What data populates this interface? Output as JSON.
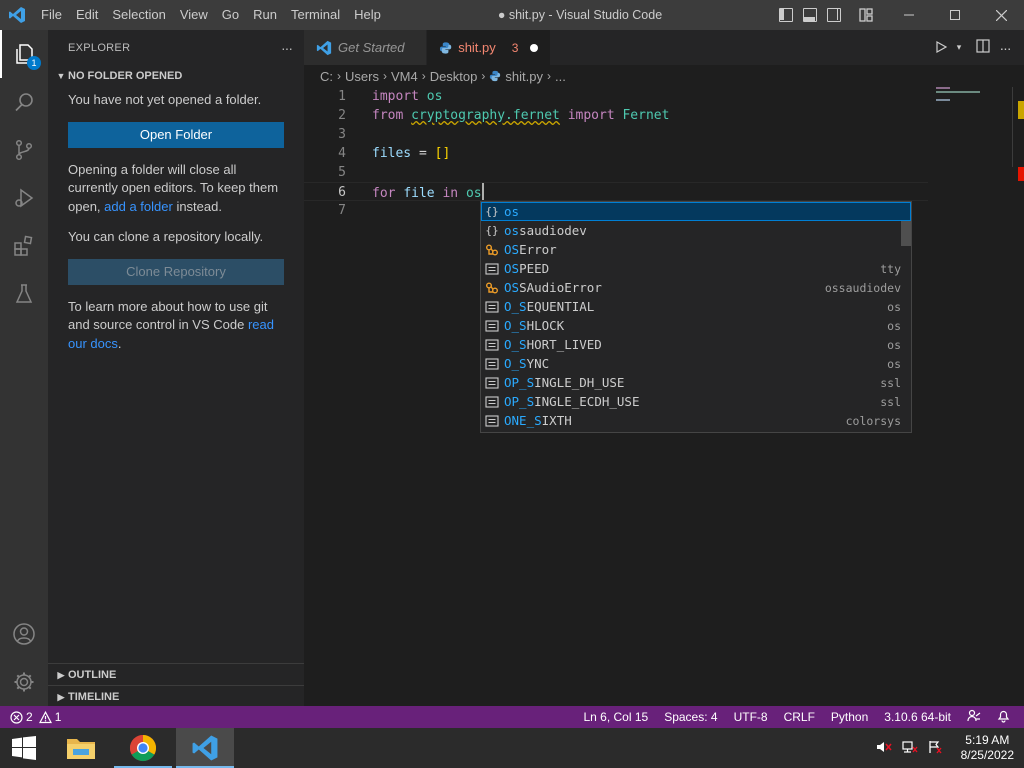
{
  "window": {
    "title": "● shit.py - Visual Studio Code"
  },
  "menu": [
    "File",
    "Edit",
    "Selection",
    "View",
    "Go",
    "Run",
    "Terminal",
    "Help"
  ],
  "activity": {
    "explorer_badge": "1"
  },
  "sidebar": {
    "header": "EXPLORER",
    "more": "···",
    "section": "NO FOLDER OPENED",
    "no_folder_text": "You have not yet opened a folder.",
    "open_folder_label": "Open Folder",
    "opening_text": "Opening a folder will close all currently open editors. To keep them open, ",
    "add_folder_link": "add a folder",
    "instead_text": " instead.",
    "clone_text": "You can clone a repository locally.",
    "clone_label": "Clone Repository",
    "git_text": "To learn more about how to use git and source control in VS Code ",
    "read_docs_link": "read our docs",
    "period": ".",
    "outline": "OUTLINE",
    "timeline": "TIMELINE"
  },
  "tabs": [
    {
      "label": "Get Started"
    },
    {
      "label": "shit.py",
      "problems": "3"
    }
  ],
  "breadcrumb": {
    "drive": "C:",
    "users": "Users",
    "user": "VM4",
    "desktop": "Desktop",
    "file": "shit.py",
    "more": "..."
  },
  "editor": {
    "line_numbers": [
      "1",
      "2",
      "3",
      "4",
      "5",
      "6",
      "7"
    ],
    "l1": {
      "kw": "import",
      "mod": "os"
    },
    "l2": {
      "kw1": "from",
      "mod": "cryptography.fernet",
      "kw2": "import",
      "cls": "Fernet"
    },
    "l4": {
      "var": "files",
      "op": " = ",
      "br": "[]"
    },
    "l6": {
      "kw1": "for",
      "var": "file",
      "kw2": "in",
      "mod": "os"
    }
  },
  "suggest": {
    "items": [
      {
        "icon": "{}",
        "hl": "os",
        "rest": "",
        "detail": ""
      },
      {
        "icon": "{}",
        "hl": "os",
        "rest": "saudiodev",
        "detail": ""
      },
      {
        "icon": "class",
        "hl": "OS",
        "rest": "Error",
        "detail": ""
      },
      {
        "icon": "var",
        "hl": "OS",
        "rest": "PEED",
        "detail": "tty"
      },
      {
        "icon": "class",
        "hl": "OS",
        "rest": "SAudioError",
        "detail": "ossaudiodev"
      },
      {
        "icon": "var",
        "hl": "O_S",
        "rest": "EQUENTIAL",
        "detail": "os"
      },
      {
        "icon": "var",
        "hl": "O_S",
        "rest": "HLOCK",
        "detail": "os"
      },
      {
        "icon": "var",
        "hl": "O_S",
        "rest": "HORT_LIVED",
        "detail": "os"
      },
      {
        "icon": "var",
        "hl": "O_S",
        "rest": "YNC",
        "detail": "os"
      },
      {
        "icon": "var",
        "hl": "OP_S",
        "rest": "INGLE_DH_USE",
        "detail": "ssl"
      },
      {
        "icon": "var",
        "hl": "OP_S",
        "rest": "INGLE_ECDH_USE",
        "detail": "ssl"
      },
      {
        "icon": "var",
        "hl": "ONE_S",
        "rest": "IXTH",
        "detail": "colorsys"
      }
    ]
  },
  "status": {
    "errors": "2",
    "warnings": "1",
    "position": "Ln 6, Col 15",
    "spaces": "Spaces: 4",
    "encoding": "UTF-8",
    "eol": "CRLF",
    "language": "Python",
    "interpreter": "3.10.6 64-bit"
  },
  "taskbar": {
    "time": "5:19 AM",
    "date": "8/25/2022"
  },
  "colors": {
    "accent": "#007acc",
    "statusbar": "#68217a",
    "keyword": "#c586c0",
    "module": "#4ec9b0",
    "match": "#2aaaff"
  }
}
